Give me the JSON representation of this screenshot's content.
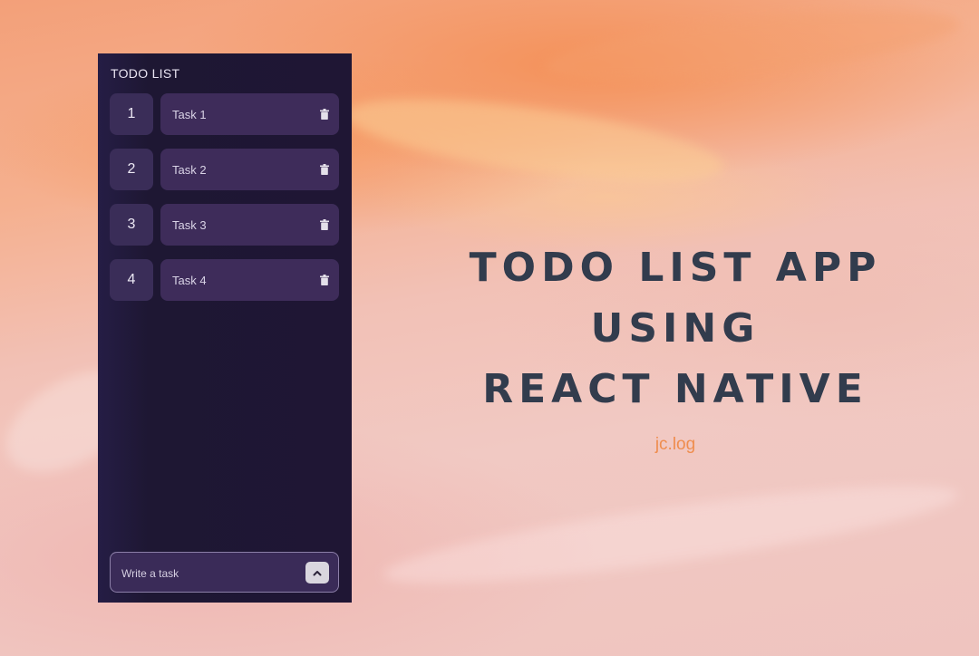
{
  "app": {
    "title": "TODO LIST",
    "tasks": [
      {
        "number": "1",
        "text": "Task 1"
      },
      {
        "number": "2",
        "text": "Task 2"
      },
      {
        "number": "3",
        "text": "Task 3"
      },
      {
        "number": "4",
        "text": "Task 4"
      }
    ],
    "input": {
      "placeholder": "Write a task",
      "value": ""
    },
    "icons": {
      "delete": "trash-icon",
      "add": "chevron-up-icon"
    }
  },
  "headline": {
    "line1": "TODO LIST APP",
    "line2": "USING",
    "line3": "REACT NATIVE"
  },
  "byline": "jc.log",
  "colors": {
    "panel": "#1f1634",
    "card": "#3e2c5a",
    "headline": "#323c4d",
    "accent": "#ef8d4e"
  }
}
